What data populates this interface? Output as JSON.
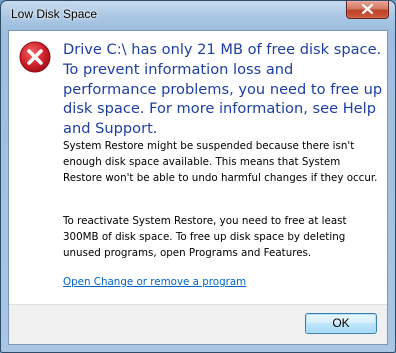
{
  "window": {
    "title": "Low Disk Space"
  },
  "dialog": {
    "main_instruction": "Drive C:\\ has only 21 MB of free disk space. To prevent information loss and performance problems, you need to free up disk space. For more information, see Help and Support.",
    "paragraph_1": "System Restore might be suspended because there isn't enough disk space available. This means that System Restore won't be able to undo harmful changes if they occur.",
    "paragraph_2": "To reactivate System Restore, you need to free at least 300MB of disk space. To free up disk space by deleting unused programs, open Programs and Features.",
    "link_text": "Open Change or remove a program",
    "icon": "error-icon"
  },
  "buttons": {
    "ok_label": "OK",
    "close_icon": "close-icon"
  },
  "colors": {
    "instruction_blue": "#1d3fa0",
    "link_blue": "#0066cc",
    "error_red": "#c8161d"
  }
}
